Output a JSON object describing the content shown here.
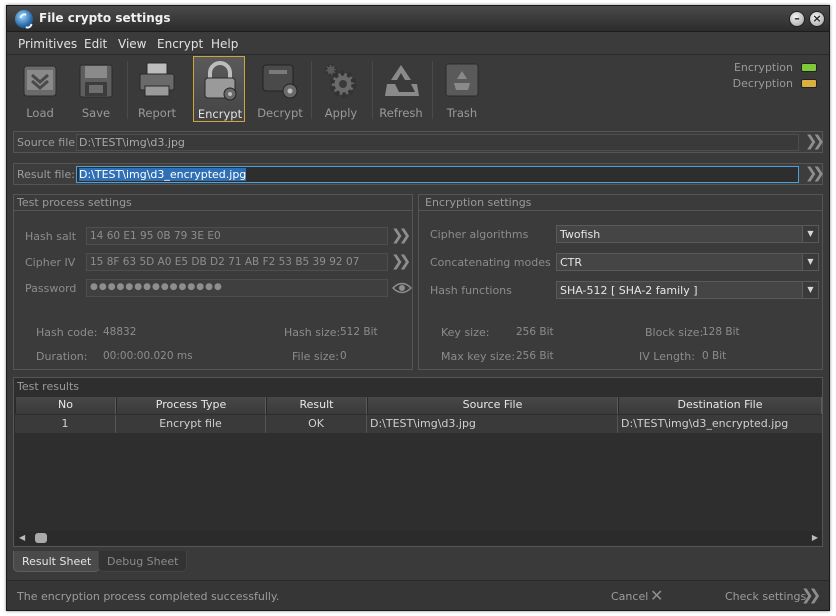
{
  "window": {
    "title": "File crypto settings",
    "minimize_symbol": "–",
    "close_symbol": "×"
  },
  "menu": [
    "Primitives",
    "Edit",
    "View",
    "Encrypt",
    "Help"
  ],
  "toolbar": {
    "items": [
      {
        "label": "Load",
        "icon": "folder-icon"
      },
      {
        "label": "Save",
        "icon": "floppy-icon"
      },
      {
        "label": "Report",
        "icon": "printer-icon"
      },
      {
        "label": "Encrypt",
        "icon": "lock-icon",
        "active": true
      },
      {
        "label": "Decrypt",
        "icon": "decrypt-icon"
      },
      {
        "label": "Apply",
        "icon": "gear-icon"
      },
      {
        "label": "Refresh",
        "icon": "recycle-icon"
      },
      {
        "label": "Trash",
        "icon": "trash-icon"
      }
    ],
    "indicators": [
      {
        "label": "Encryption",
        "color": "#7dc93a"
      },
      {
        "label": "Decryption",
        "color": "#d8b040"
      }
    ]
  },
  "source_file": {
    "label": "Source file:",
    "value": "D:\\TEST\\img\\d3.jpg"
  },
  "result_file": {
    "label": "Result file:",
    "value": "D:\\TEST\\img\\d3_encrypted.jpg"
  },
  "test_process": {
    "title": "Test process settings",
    "hash_salt": {
      "label": "Hash salt",
      "value": "14 60 E1 95 0B 79 3E E0"
    },
    "cipher_iv": {
      "label": "Cipher IV",
      "value": "15 8F 63 5D A0 E5 DB D2 71 AB F2 53 B5 39 92 07"
    },
    "password": {
      "label": "Password",
      "value": "●●●●●●●●●●●●●●●"
    },
    "hash_code": {
      "label": "Hash code:",
      "value": "48832"
    },
    "duration": {
      "label": "Duration:",
      "value": "00:00:00.020 ms"
    },
    "hash_size": {
      "label": "Hash size:",
      "value": "512 Bit"
    },
    "file_size": {
      "label": "File size:",
      "value": "0"
    }
  },
  "encryption": {
    "title": "Encryption settings",
    "cipher": {
      "label": "Cipher algorithms",
      "value": "Twofish"
    },
    "mode": {
      "label": "Concatenating modes",
      "value": "CTR"
    },
    "hash": {
      "label": "Hash functions",
      "value": "SHA-512 [ SHA-2 family ]"
    },
    "key_size": {
      "label": "Key size:",
      "value": "256 Bit"
    },
    "max_key_size": {
      "label": "Max key size:",
      "value": "256 Bit"
    },
    "block_size": {
      "label": "Block size:",
      "value": "128 Bit"
    },
    "iv_length": {
      "label": "IV Length:",
      "value": "0 Bit"
    }
  },
  "results": {
    "title": "Test results",
    "columns": [
      "No",
      "Process Type",
      "Result",
      "Source File",
      "Destination File"
    ],
    "rows": [
      [
        "1",
        "Encrypt file",
        "OK",
        "D:\\TEST\\img\\d3.jpg",
        "D:\\TEST\\img\\d3_encrypted.jpg"
      ]
    ]
  },
  "tabs": [
    "Result Sheet",
    "Debug Sheet"
  ],
  "status": {
    "message": "The encryption process completed successfully.",
    "cancel_label": "Cancel",
    "check_label": "Check settings"
  }
}
